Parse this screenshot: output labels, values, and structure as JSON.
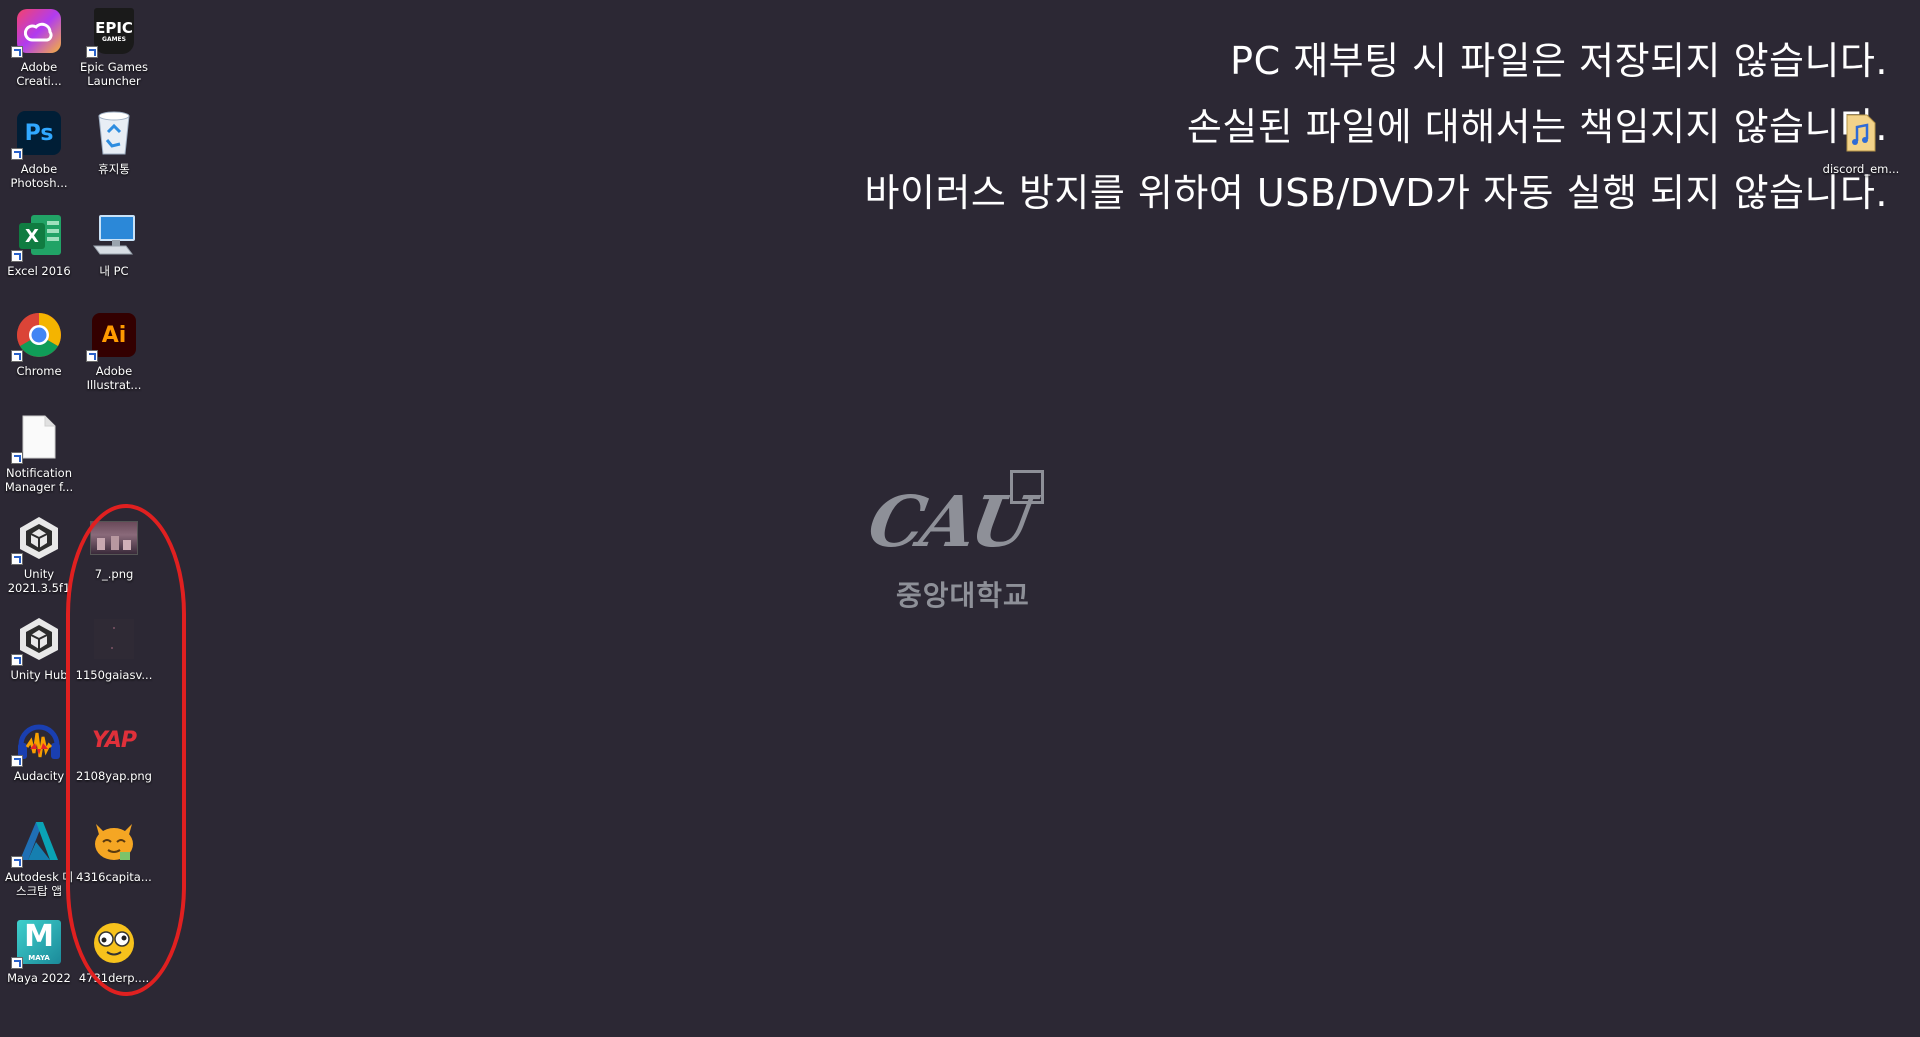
{
  "notice": {
    "line1": "PC 재부팅 시 파일은 저장되지 않습니다.",
    "line2": "손실된 파일에 대해서는 책임지지 않습니다.",
    "line3": "바이러스 방지를 위하여 USB/DVD가 자동 실행 되지 않습니다."
  },
  "logo": {
    "text": "CAU",
    "korean": "중앙대학교"
  },
  "icons": {
    "adobe_creative": "Adobe Creati...",
    "epic_games": "Epic Games Launcher",
    "photoshop": "Adobe Photosh...",
    "recycle_bin": "휴지통",
    "excel": "Excel 2016",
    "my_pc": "내 PC",
    "chrome": "Chrome",
    "illustrator": "Adobe Illustrat...",
    "notification_manager": "Notification Manager f...",
    "unity": "Unity 2021.3.5f1",
    "file_7png": "7_.png",
    "unity_hub": "Unity Hub",
    "file_1150": "1150gaiasv...",
    "audacity": "Audacity",
    "file_2108": "2108yap.png",
    "autodesk": "Autodesk 데스크탑 앱",
    "file_4316": "4316capita...",
    "maya": "Maya 2022",
    "file_4731": "4731derp....",
    "discord": "discord_em..."
  },
  "glyphs": {
    "ps": "Ps",
    "ai": "Ai",
    "xl": "X",
    "epic": "EPIC",
    "epic_sub": "GAMES",
    "yap": "YAP",
    "maya": "M",
    "maya_sub": "MAYA"
  },
  "colors": {
    "desktop_bg": "#2c2834",
    "highlight": "#e02020"
  }
}
